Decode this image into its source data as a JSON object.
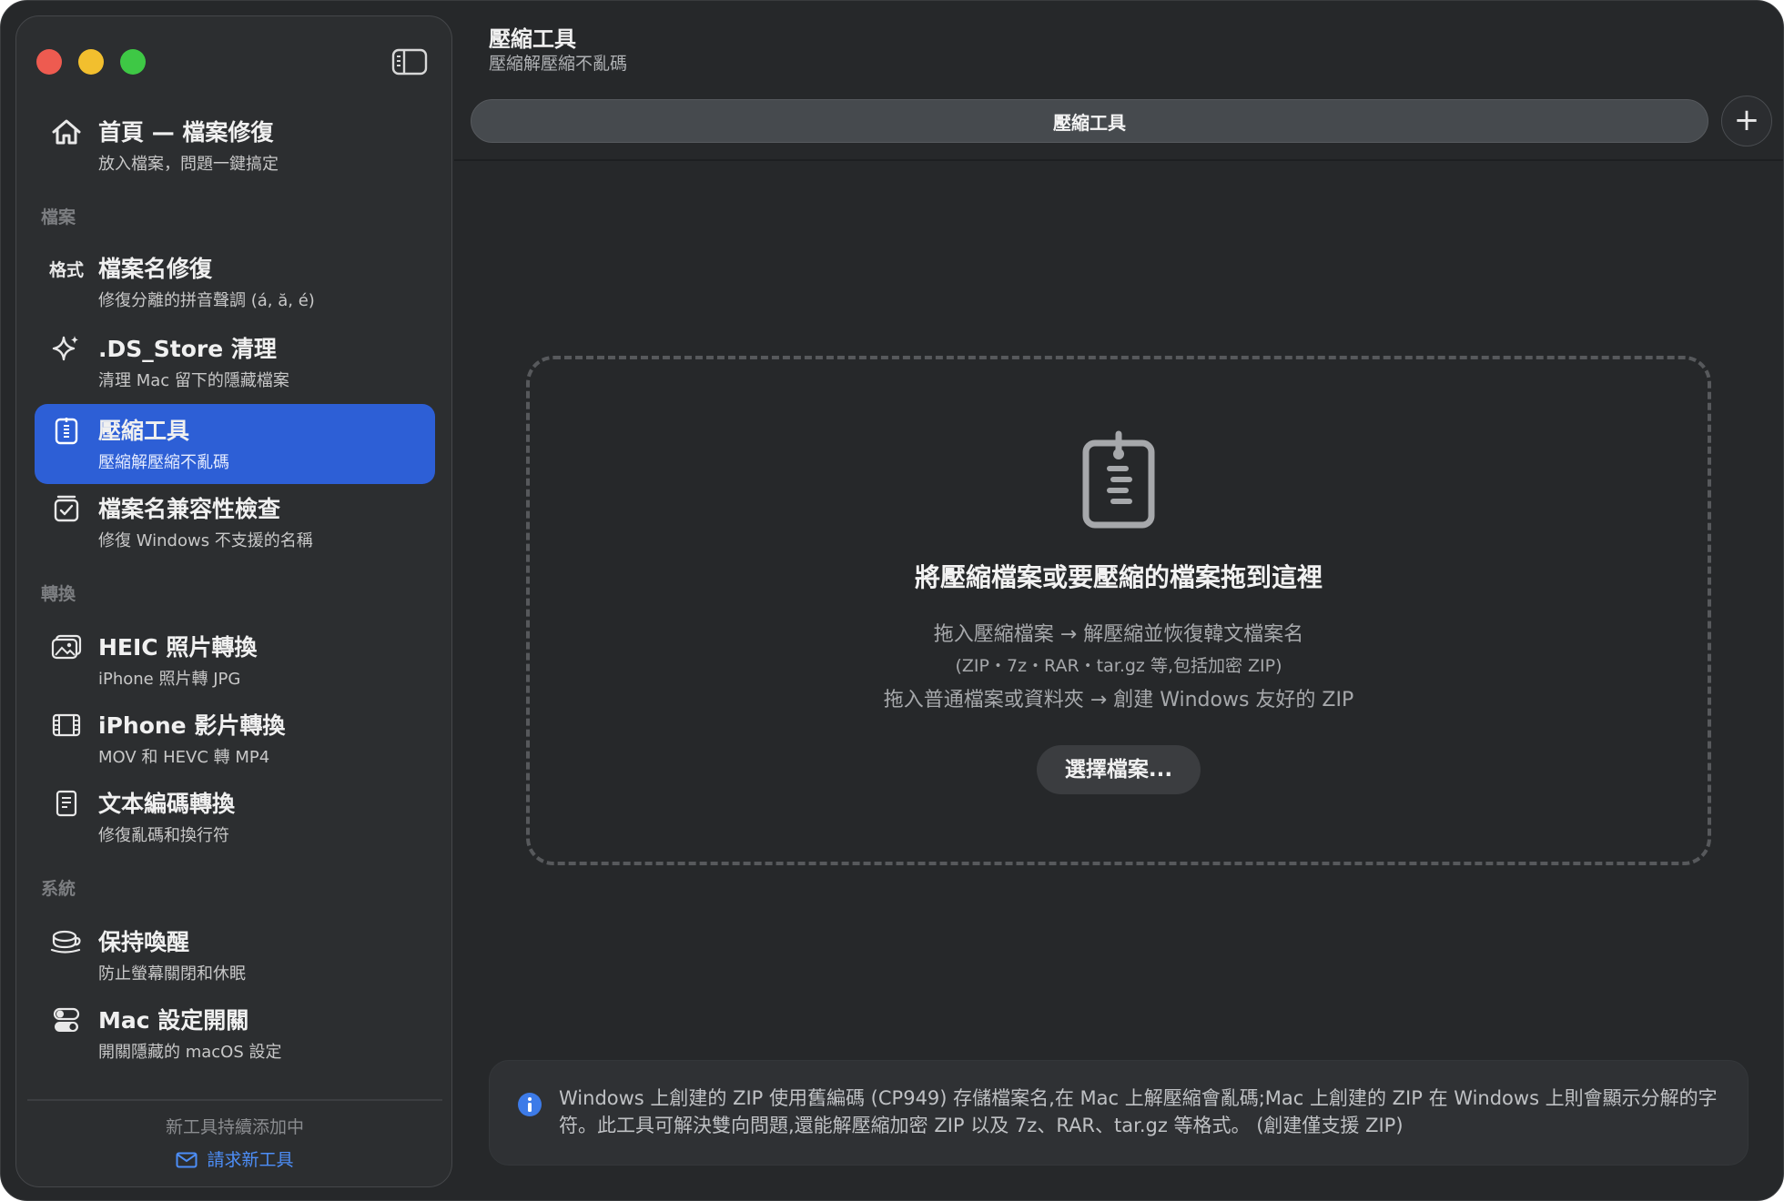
{
  "window": {
    "controls": [
      "close",
      "minimize",
      "zoom"
    ]
  },
  "sidebar": {
    "home": {
      "title": "首頁 — 檔案修復",
      "subtitle": "放入檔案，問題一鍵搞定",
      "icon": "house-icon"
    },
    "sections": [
      {
        "label": "檔案"
      },
      {
        "label": "轉換"
      },
      {
        "label": "系統"
      }
    ],
    "items": [
      {
        "title": "檔案名修復",
        "subtitle": "修復分離的拼音聲調 (á, ă, é)",
        "icon_text": "格式",
        "icon": "format-text-icon"
      },
      {
        "title": ".DS_Store 清理",
        "subtitle": "清理 Mac 留下的隱藏檔案",
        "icon": "sparkles-icon"
      },
      {
        "title": "壓縮工具",
        "subtitle": "壓縮解壓縮不亂碼",
        "icon": "zipper-document-icon",
        "selected": true
      },
      {
        "title": "檔案名兼容性檢查",
        "subtitle": "修復 Windows 不支援的名稱",
        "icon": "checklist-icon"
      },
      {
        "title": "HEIC 照片轉換",
        "subtitle": "iPhone 照片轉 JPG",
        "icon": "photos-icon"
      },
      {
        "title": "iPhone 影片轉換",
        "subtitle": "MOV 和 HEVC 轉 MP4",
        "icon": "film-icon"
      },
      {
        "title": "文本編碼轉換",
        "subtitle": "修復亂碼和換行符",
        "icon": "text-document-icon"
      },
      {
        "title": "保持喚醒",
        "subtitle": "防止螢幕關閉和休眠",
        "icon": "coffee-cup-icon"
      },
      {
        "title": "Mac 設定開關",
        "subtitle": "開關隱藏的 macOS 設定",
        "icon": "toggles-icon"
      }
    ],
    "footer": {
      "text": "新工具持續添加中",
      "link": "請求新工具"
    }
  },
  "main": {
    "title": "壓縮工具",
    "subtitle": "壓縮解壓縮不亂碼",
    "tab_label": "壓縮工具",
    "add_tab_label": "+",
    "drop_zone": {
      "title": "將壓縮檔案或要壓縮的檔案拖到這裡",
      "line1": "拖入壓縮檔案 → 解壓縮並恢復韓文檔案名",
      "line2": "(ZIP・7z・RAR・tar.gz 等,包括加密 ZIP)",
      "line3": "拖入普通檔案或資料夾 → 創建 Windows 友好的 ZIP",
      "button": "選擇檔案..."
    },
    "info": "Windows 上創建的 ZIP 使用舊編碼 (CP949) 存儲檔案名,在 Mac 上解壓縮會亂碼;Mac 上創建的 ZIP 在 Windows 上則會顯示分解的字符。此工具可解決雙向問題,還能解壓縮加密 ZIP 以及 7z、RAR、tar.gz 等格式。 (創建僅支援 ZIP)"
  },
  "colors": {
    "accent": "#2d5fd6",
    "link": "#4d8ef7",
    "info": "#3d7be8",
    "close": "#ee5b50",
    "minimize": "#f2bf2e",
    "zoom": "#3ec845"
  }
}
